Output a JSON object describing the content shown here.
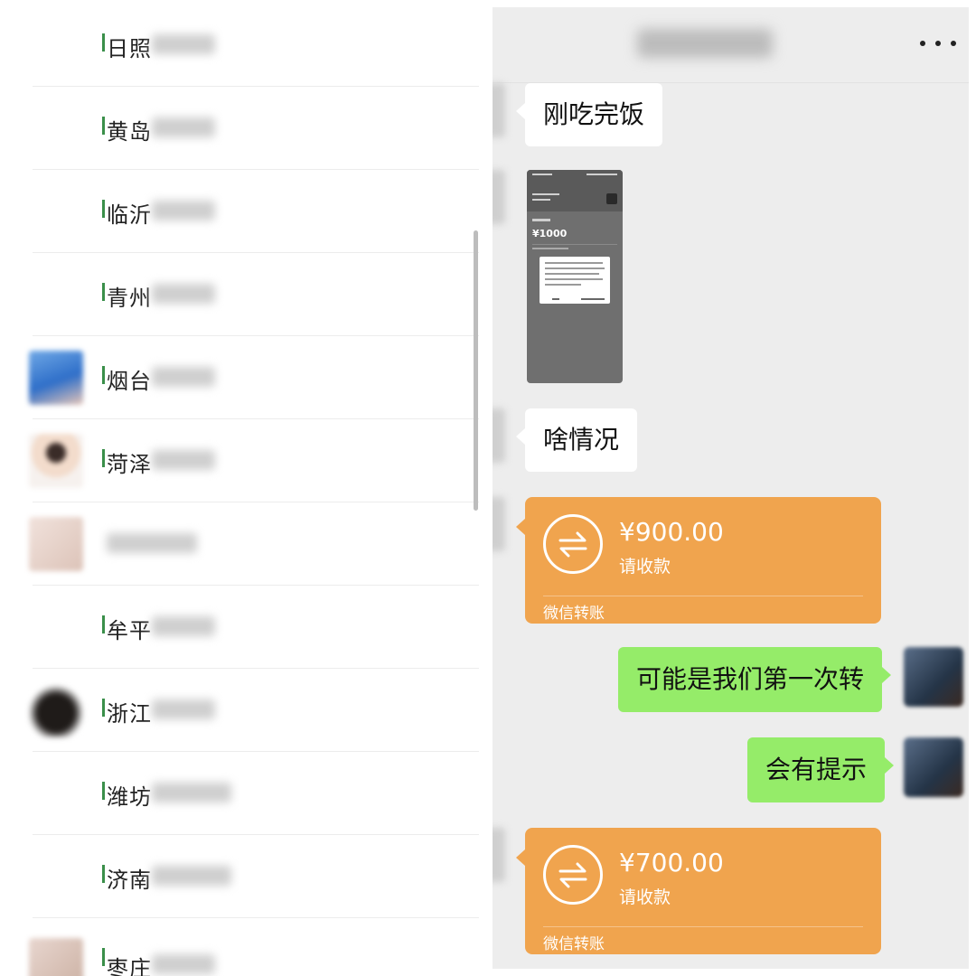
{
  "contacts": [
    {
      "name": "日照",
      "avatar": "none"
    },
    {
      "name": "黄岛",
      "avatar": "none"
    },
    {
      "name": "临沂",
      "avatar": "none"
    },
    {
      "name": "青州",
      "avatar": "none"
    },
    {
      "name": "烟台",
      "avatar": "blue-photo"
    },
    {
      "name": "菏泽",
      "avatar": "child-photo"
    },
    {
      "name": "",
      "avatar": "pink-photo"
    },
    {
      "name": "牟平",
      "avatar": "none"
    },
    {
      "name": "浙江",
      "avatar": "dark-photo"
    },
    {
      "name": "潍坊",
      "avatar": "none"
    },
    {
      "name": "济南",
      "avatar": "none"
    },
    {
      "name": "枣庄",
      "avatar": "beige-photo"
    }
  ],
  "chat": {
    "more_icon": "more-dots-icon",
    "messages": [
      {
        "type": "text",
        "from": "peer",
        "text": "刚吃完饭"
      },
      {
        "type": "image",
        "from": "peer",
        "amount_text": "¥1000"
      },
      {
        "type": "text",
        "from": "peer",
        "text": "啥情况"
      },
      {
        "type": "transfer",
        "from": "peer",
        "amount": "¥900.00",
        "status": "请收款",
        "brand": "微信转账"
      },
      {
        "type": "text",
        "from": "me",
        "text": "可能是我们第一次转"
      },
      {
        "type": "text",
        "from": "me",
        "text": "会有提示"
      },
      {
        "type": "transfer",
        "from": "peer",
        "amount": "¥700.00",
        "status": "请收款",
        "brand": "微信转账"
      }
    ]
  },
  "colors": {
    "chat_bg": "#ededed",
    "out_bubble": "#95ec69",
    "transfer_card": "#f0a44e"
  }
}
